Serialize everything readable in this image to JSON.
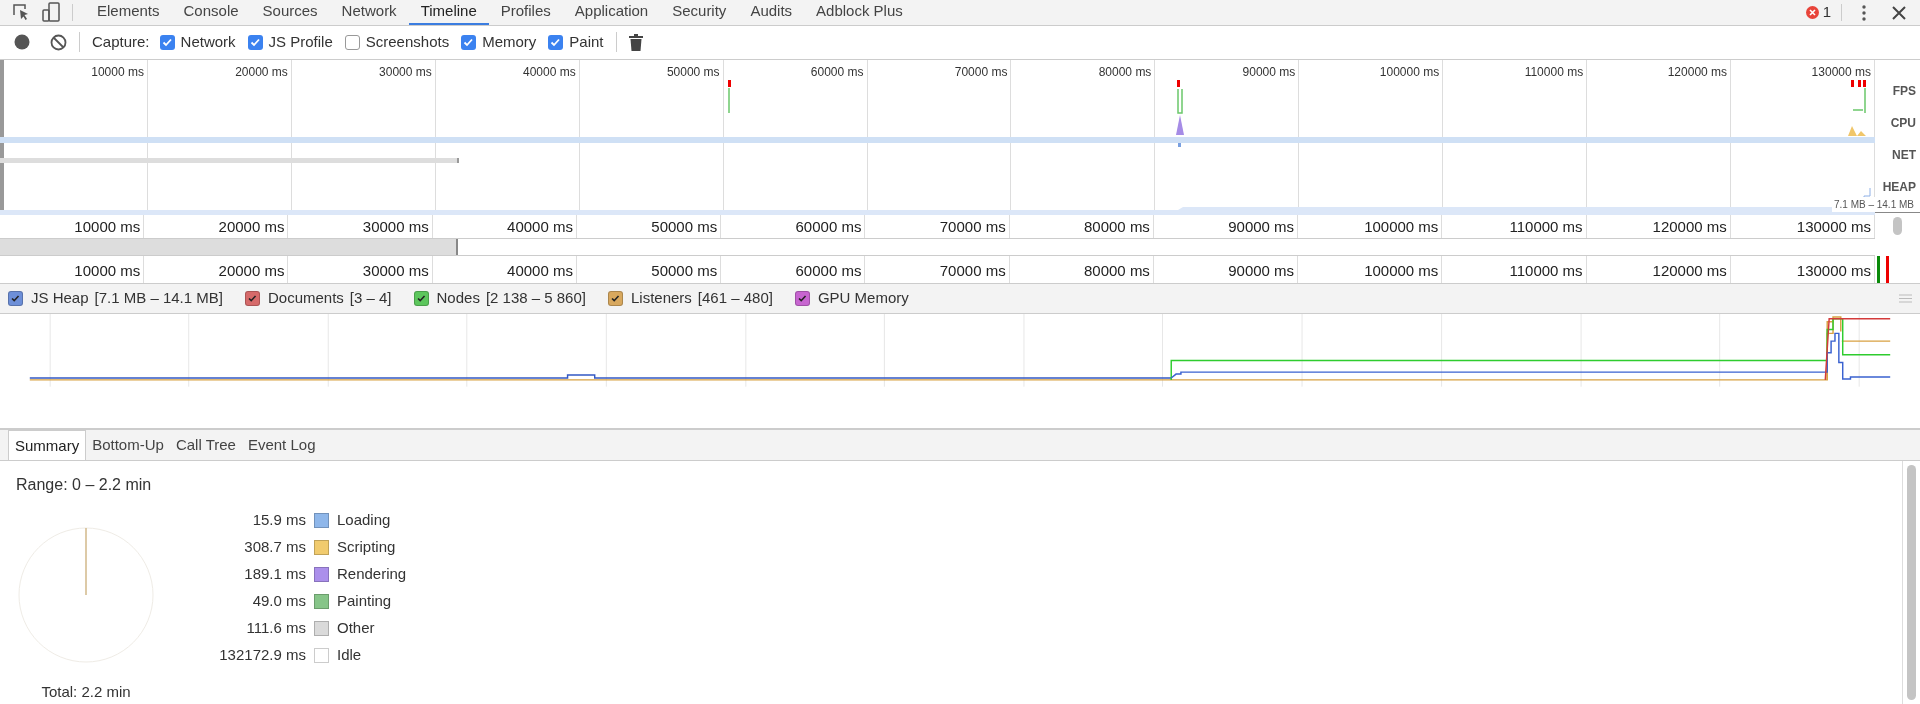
{
  "tabs": [
    {
      "label": "Elements",
      "selected": false
    },
    {
      "label": "Console",
      "selected": false
    },
    {
      "label": "Sources",
      "selected": false
    },
    {
      "label": "Network",
      "selected": false
    },
    {
      "label": "Timeline",
      "selected": true
    },
    {
      "label": "Profiles",
      "selected": false
    },
    {
      "label": "Application",
      "selected": false
    },
    {
      "label": "Security",
      "selected": false
    },
    {
      "label": "Audits",
      "selected": false
    },
    {
      "label": "Adblock Plus",
      "selected": false
    }
  ],
  "error_count": "1",
  "capture": {
    "label": "Capture:",
    "options": [
      {
        "label": "Network",
        "checked": true
      },
      {
        "label": "JS Profile",
        "checked": true
      },
      {
        "label": "Screenshots",
        "checked": false
      },
      {
        "label": "Memory",
        "checked": true
      },
      {
        "label": "Paint",
        "checked": true
      }
    ]
  },
  "overview": {
    "ticks": [
      "10000 ms",
      "20000 ms",
      "30000 ms",
      "40000 ms",
      "50000 ms",
      "60000 ms",
      "70000 ms",
      "80000 ms",
      "90000 ms",
      "100000 ms",
      "110000 ms",
      "120000 ms",
      "130000 ms"
    ],
    "track_labels": [
      "FPS",
      "CPU",
      "NET",
      "HEAP"
    ],
    "heap_range": "7.1 MB – 14.1 MB"
  },
  "ruler_ticks": [
    "10000 ms",
    "20000 ms",
    "30000 ms",
    "40000 ms",
    "50000 ms",
    "60000 ms",
    "70000 ms",
    "80000 ms",
    "90000 ms",
    "100000 ms",
    "110000 ms",
    "120000 ms",
    "130000 ms"
  ],
  "flame_ruler_ticks": [
    "10000 ms",
    "20000 ms",
    "30000 ms",
    "40000 ms",
    "50000 ms",
    "60000 ms",
    "70000 ms",
    "80000 ms",
    "90000 ms",
    "100000 ms",
    "110000 ms",
    "120000 ms",
    "130000 ms"
  ],
  "memory_counters": [
    {
      "label": "JS Heap",
      "range": "[7.1 MB – 14.1 MB]",
      "checked": true,
      "color": "#6d8fd8"
    },
    {
      "label": "Documents",
      "range": "[3 – 4]",
      "checked": true,
      "color": "#d66a6a"
    },
    {
      "label": "Nodes",
      "range": "[2 138 – 5 860]",
      "checked": true,
      "color": "#5cc65c"
    },
    {
      "label": "Listeners",
      "range": "[461 – 480]",
      "checked": true,
      "color": "#d8a85e"
    },
    {
      "label": "GPU Memory",
      "checked": true,
      "color": "#c765d0"
    }
  ],
  "detail_tabs": [
    {
      "label": "Summary",
      "selected": true
    },
    {
      "label": "Bottom-Up",
      "selected": false
    },
    {
      "label": "Call Tree",
      "selected": false
    },
    {
      "label": "Event Log",
      "selected": false
    }
  ],
  "summary": {
    "range": "Range: 0 – 2.2 min",
    "items": [
      {
        "value": "15.9 ms",
        "label": "Loading",
        "color": "#8fb7ea"
      },
      {
        "value": "308.7 ms",
        "label": "Scripting",
        "color": "#f1cb6e"
      },
      {
        "value": "189.1 ms",
        "label": "Rendering",
        "color": "#ab8feb"
      },
      {
        "value": "49.0 ms",
        "label": "Painting",
        "color": "#87c589"
      },
      {
        "value": "111.6 ms",
        "label": "Other",
        "color": "#dadada"
      },
      {
        "value": "132172.9 ms",
        "label": "Idle",
        "color": "#ffffff"
      }
    ],
    "total": "Total: 2.2 min"
  }
}
